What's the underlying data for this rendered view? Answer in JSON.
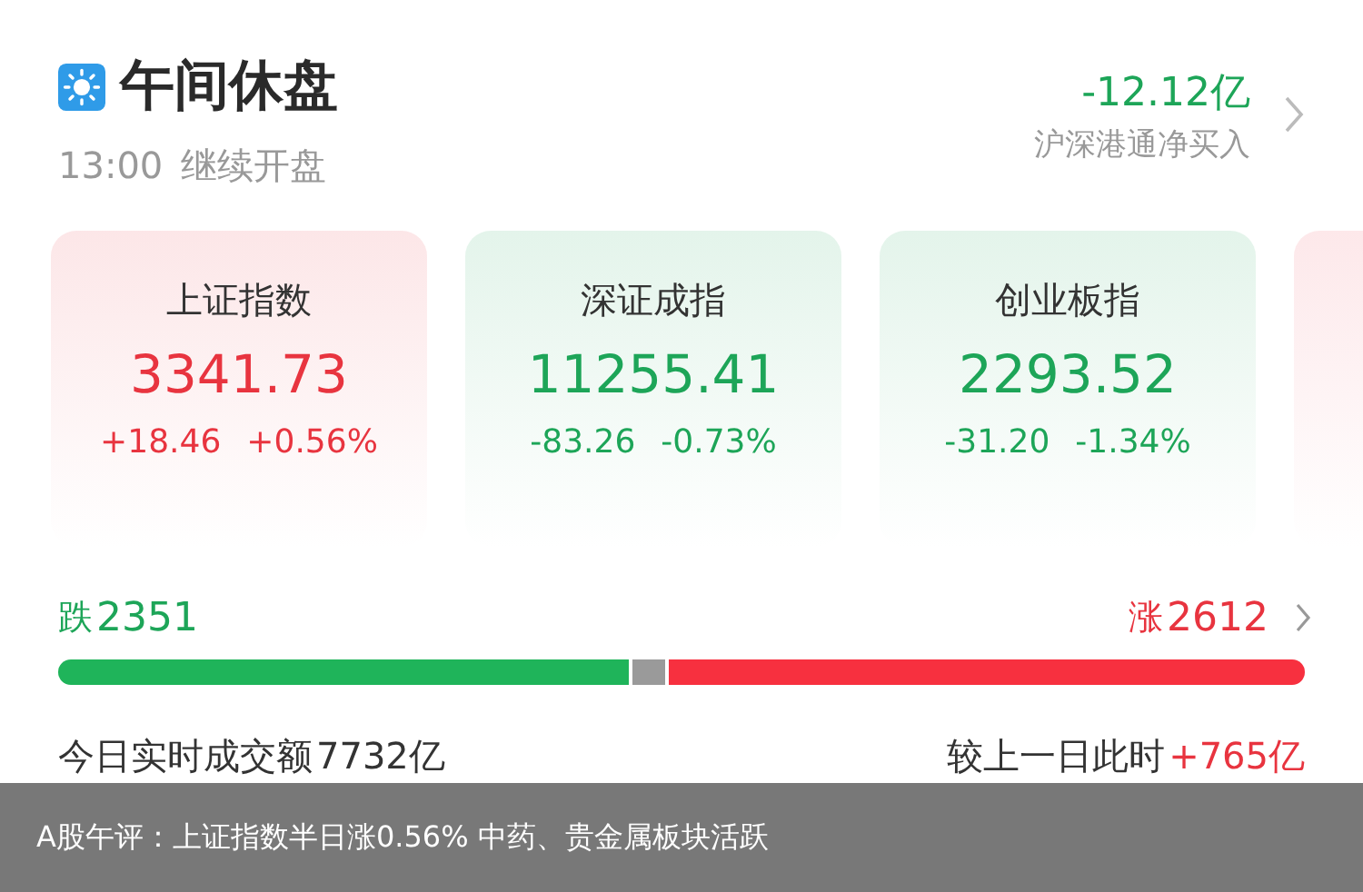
{
  "header": {
    "title": "午间休盘",
    "resume_time": "13:00",
    "resume_label": "继续开盘",
    "northbound_value": "-12.12亿",
    "northbound_label": "沪深港通净买入"
  },
  "indices": [
    {
      "name": "上证指数",
      "value": "3341.73",
      "change": "+18.46",
      "percent": "+0.56%",
      "color": "#e8343f"
    },
    {
      "name": "深证成指",
      "value": "11255.41",
      "change": "-83.26",
      "percent": "-0.73%",
      "color": "#1da558"
    },
    {
      "name": "创业板指",
      "value": "2293.52",
      "change": "-31.20",
      "percent": "-1.34%",
      "color": "#1da558"
    }
  ],
  "breadth": {
    "fall_label": "跌",
    "fall_count": "2351",
    "rise_label": "涨",
    "rise_count": "2612",
    "segments": [
      {
        "kind": "fall"
      },
      {
        "kind": "flat"
      },
      {
        "kind": "rise"
      }
    ]
  },
  "turnover": {
    "label": "今日实时成交额",
    "value": "7732亿",
    "compare_label": "较上一日此时",
    "compare_value": "+765亿"
  },
  "caption": "A股午评：上证指数半日涨0.56% 中药、贵金属板块活跃"
}
